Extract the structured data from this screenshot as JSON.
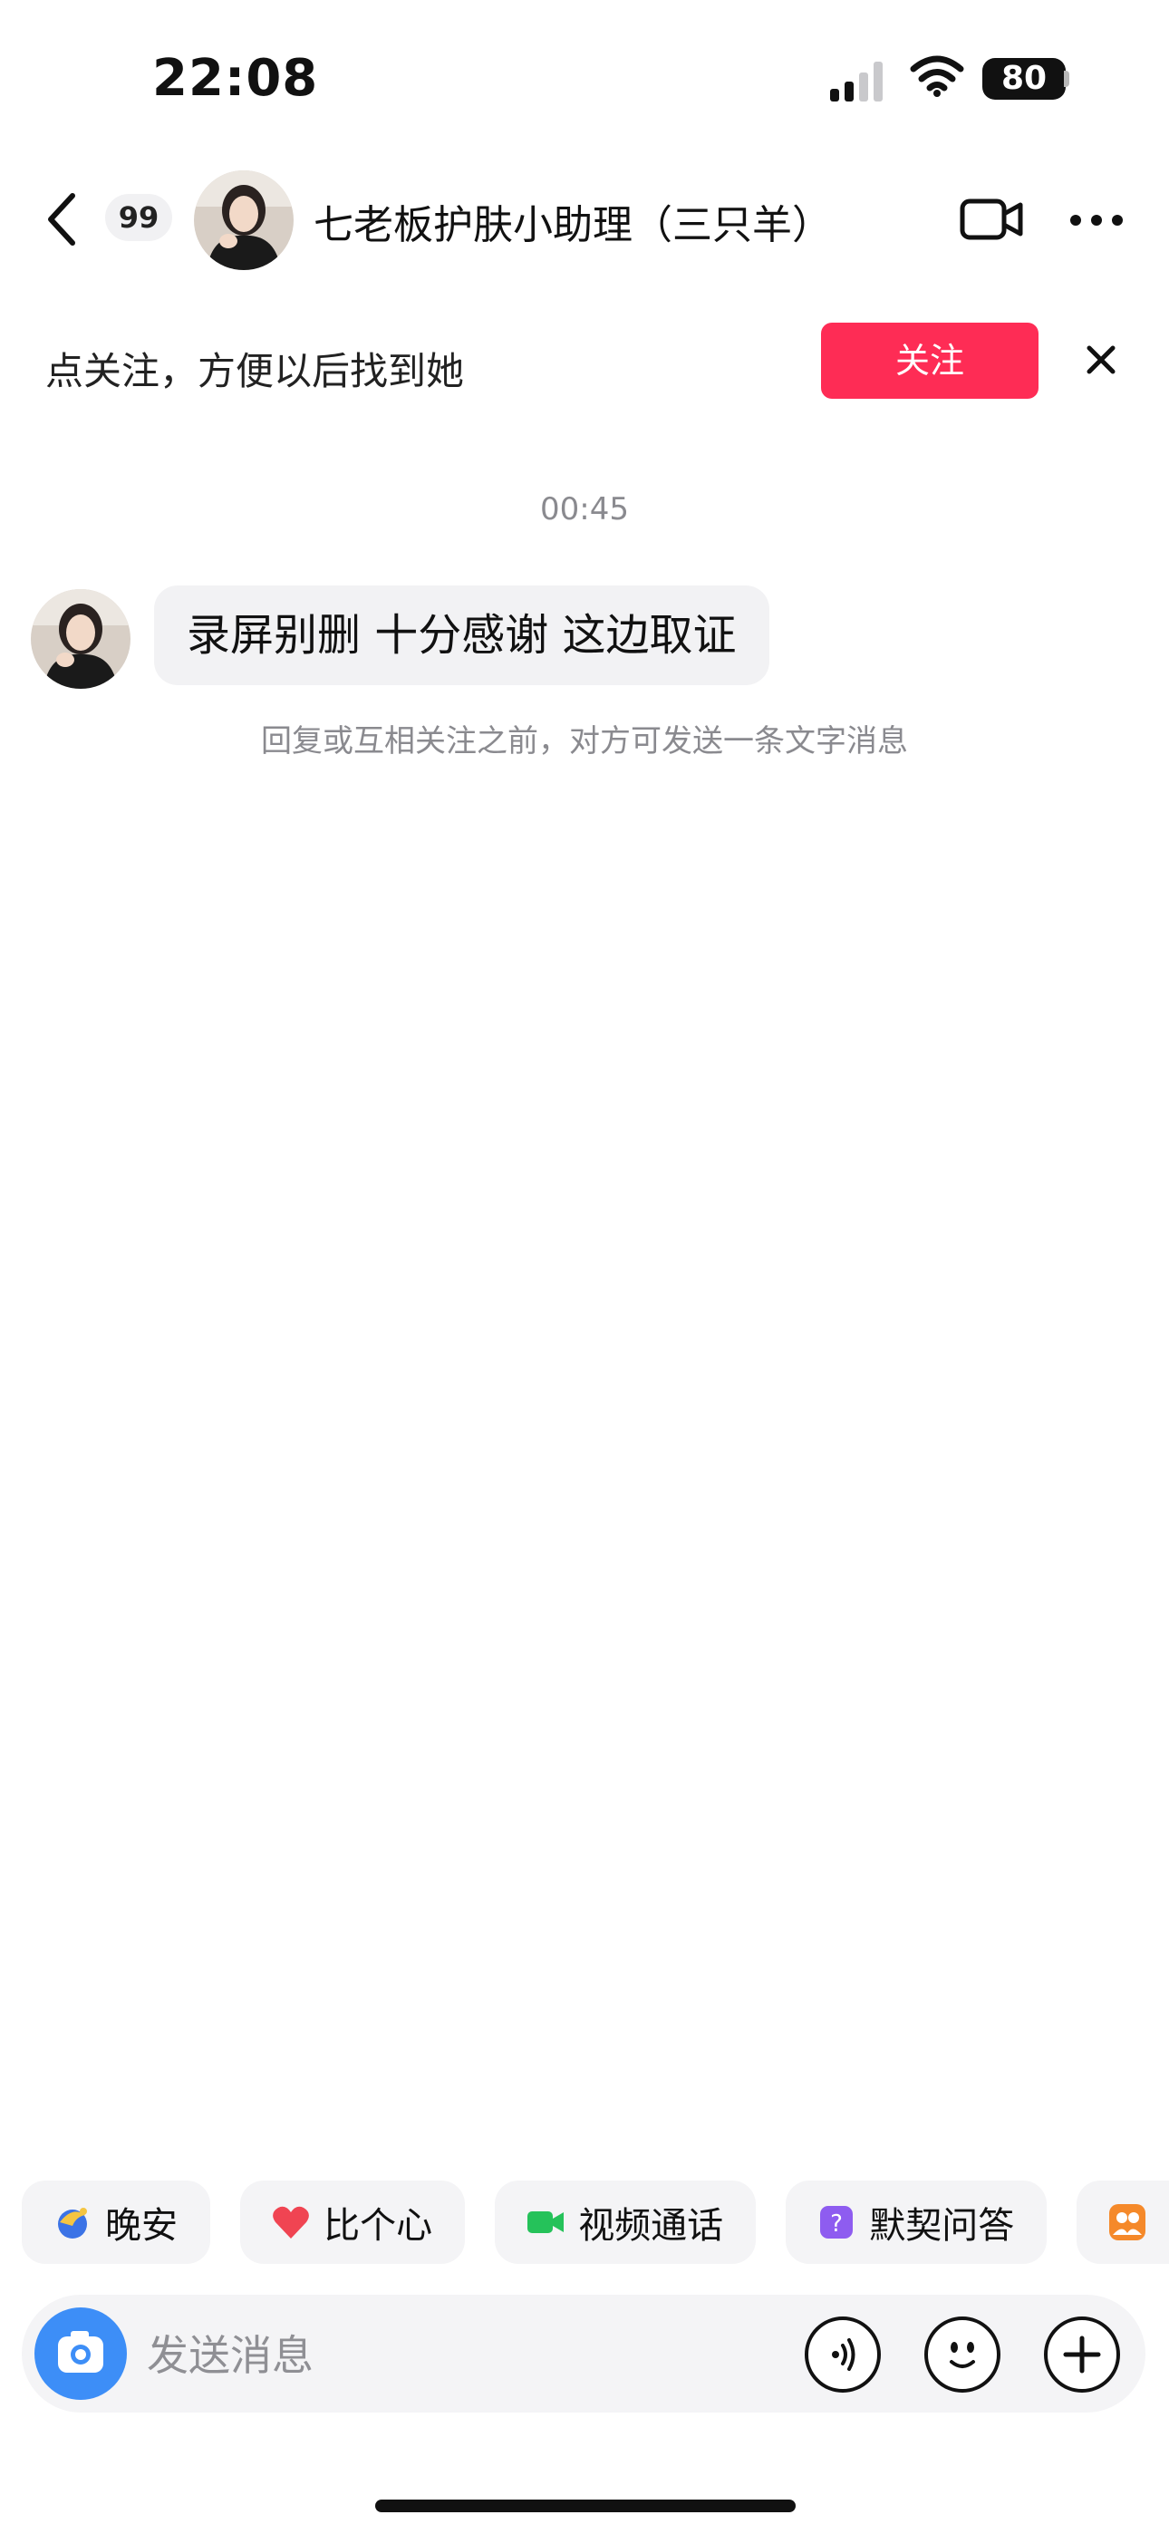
{
  "status_bar": {
    "time": "22:08",
    "battery": "80"
  },
  "header": {
    "unread_count": "99",
    "title": "七老板护肤小助理（三只羊）"
  },
  "follow_banner": {
    "text": "点关注，方便以后找到她",
    "button_label": "关注"
  },
  "chat": {
    "timestamp": "00:45",
    "messages": [
      {
        "from": "other",
        "text": "录屏别删 十分感谢 这边取证"
      }
    ],
    "notice": "回复或互相关注之前，对方可发送一条文字消息"
  },
  "quick_replies": [
    {
      "label": "晚安",
      "icon": "moon-icon"
    },
    {
      "label": "比个心",
      "icon": "heart-icon"
    },
    {
      "label": "视频通话",
      "icon": "video-call-icon"
    },
    {
      "label": "默契问答",
      "icon": "question-icon"
    },
    {
      "label": "",
      "icon": "group-icon"
    }
  ],
  "input": {
    "placeholder": "发送消息"
  },
  "colors": {
    "accent": "#fe2c55",
    "camera": "#3d8ef7",
    "bubble": "#f2f2f4"
  }
}
